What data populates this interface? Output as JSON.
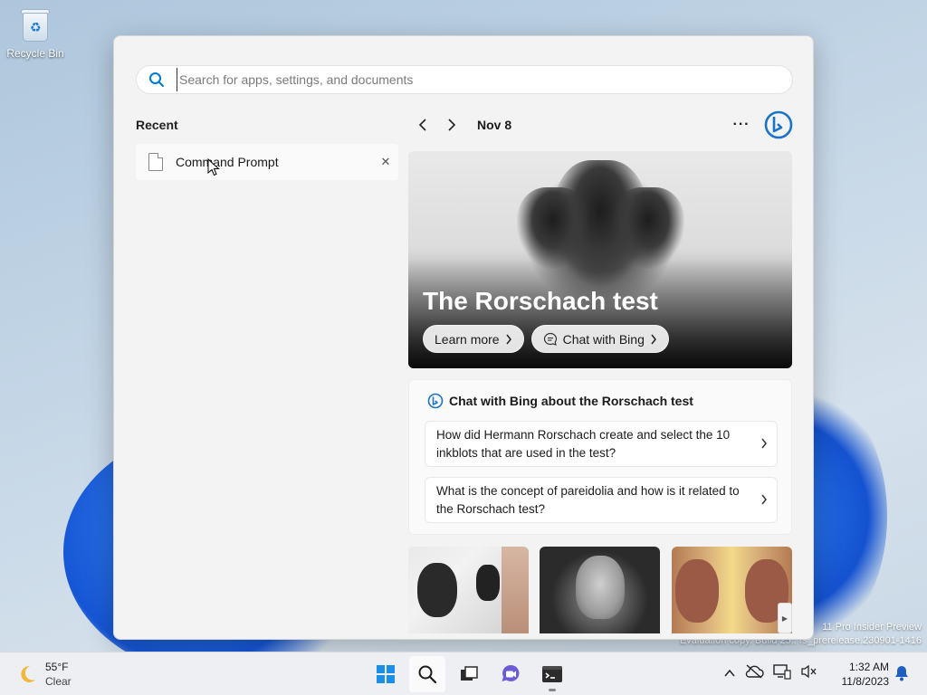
{
  "desktop": {
    "icons": [
      {
        "label": "Recycle Bin",
        "icon": "recycle-bin-icon"
      }
    ],
    "watermark": {
      "line1": "11 Pro Insider Preview",
      "line2": "Evaluation copy. Build 25.. rs_prerelease.230901-1416"
    }
  },
  "search": {
    "placeholder": "Search for apps, settings, and documents",
    "value": ""
  },
  "recent": {
    "title": "Recent",
    "items": [
      {
        "label": "Command Prompt",
        "icon": "document-icon"
      }
    ]
  },
  "highlights": {
    "date": "Nov 8",
    "more_label": "···",
    "hero": {
      "title": "The Rorschach test",
      "learn_more": "Learn more",
      "chat_with_bing": "Chat with Bing"
    },
    "chat_card": {
      "title": "Chat with Bing about the Rorschach test",
      "questions": [
        "How did Hermann Rorschach create and select the 10 inkblots that are used in the test?",
        "What is the concept of pareidolia and how is it related to the Rorschach test?"
      ]
    }
  },
  "taskbar": {
    "weather": {
      "temp": "55°F",
      "condition": "Clear"
    },
    "apps": [
      "start-icon",
      "search-icon",
      "task-view-icon",
      "chat-icon",
      "terminal-icon"
    ],
    "clock": {
      "time": "1:32 AM",
      "date": "11/8/2023"
    }
  },
  "colors": {
    "accent": "#0078d4",
    "bing_blue": "#1a73c9",
    "panel_bg": "#f3f3f3",
    "taskbar_bg": "#eeeff2"
  }
}
